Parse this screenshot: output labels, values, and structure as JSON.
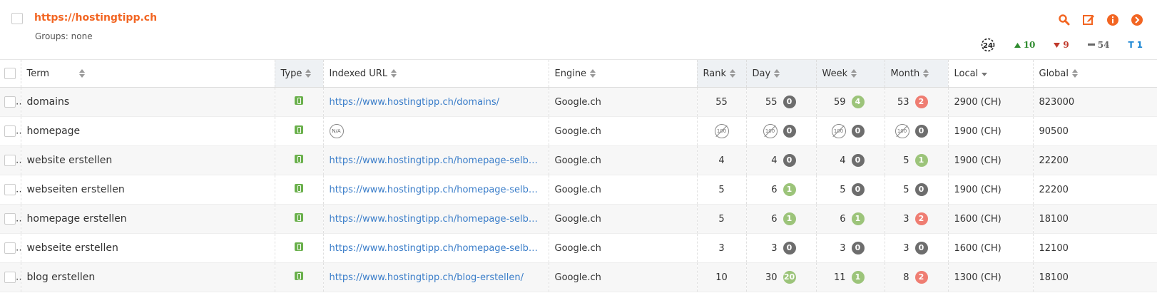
{
  "header": {
    "site_url": "https://hostingtipp.ch",
    "groups": "Groups: none",
    "stats": {
      "refresh": "24",
      "up": "10",
      "down": "9",
      "flat": "54",
      "top": "1",
      "top_prefix": "T"
    },
    "colors": {
      "accent": "#f26522",
      "up": "#2e8b2e",
      "down": "#c0392b",
      "link": "#3a7dc9"
    }
  },
  "columns": {
    "term": "Term",
    "type": "Type",
    "indexed_url": "Indexed URL",
    "engine": "Engine",
    "rank": "Rank",
    "day": "Day",
    "week": "Week",
    "month": "Month",
    "local": "Local",
    "global": "Global"
  },
  "rows": [
    {
      "term": "domains",
      "url": "https://www.hostingtipp.ch/domains/",
      "engine": "Google.ch",
      "rank": "55",
      "day": "55",
      "day_b": "0",
      "week": "59",
      "week_b": "4",
      "month": "53",
      "month_b": "2",
      "local": "2900 (CH)",
      "global": "823000"
    },
    {
      "term": "homepage",
      "url": "N/A",
      "engine": "Google.ch",
      "rank": "100",
      "day": "100",
      "day_b": "0",
      "week": "100",
      "week_b": "0",
      "month": "100",
      "month_b": "0",
      "local": "1900 (CH)",
      "global": "90500"
    },
    {
      "term": "website erstellen",
      "url": "https://www.hostingtipp.ch/homepage-selber-er...",
      "engine": "Google.ch",
      "rank": "4",
      "day": "4",
      "day_b": "0",
      "week": "4",
      "week_b": "0",
      "month": "5",
      "month_b": "1",
      "local": "1900 (CH)",
      "global": "22200"
    },
    {
      "term": "webseiten erstellen",
      "url": "https://www.hostingtipp.ch/homepage-selber-er...",
      "engine": "Google.ch",
      "rank": "5",
      "day": "6",
      "day_b": "1",
      "week": "5",
      "week_b": "0",
      "month": "5",
      "month_b": "0",
      "local": "1900 (CH)",
      "global": "22200"
    },
    {
      "term": "homepage erstellen",
      "url": "https://www.hostingtipp.ch/homepage-selber-er...",
      "engine": "Google.ch",
      "rank": "5",
      "day": "6",
      "day_b": "1",
      "week": "6",
      "week_b": "1",
      "month": "3",
      "month_b": "2",
      "local": "1600 (CH)",
      "global": "18100"
    },
    {
      "term": "webseite erstellen",
      "url": "https://www.hostingtipp.ch/homepage-selber-er...",
      "engine": "Google.ch",
      "rank": "3",
      "day": "3",
      "day_b": "0",
      "week": "3",
      "week_b": "0",
      "month": "3",
      "month_b": "0",
      "local": "1600 (CH)",
      "global": "12100"
    },
    {
      "term": "blog erstellen",
      "url": "https://www.hostingtipp.ch/blog-erstellen/",
      "engine": "Google.ch",
      "rank": "10",
      "day": "30",
      "day_b": "20",
      "week": "11",
      "week_b": "1",
      "month": "8",
      "month_b": "2",
      "local": "1300 (CH)",
      "global": "18100"
    }
  ]
}
